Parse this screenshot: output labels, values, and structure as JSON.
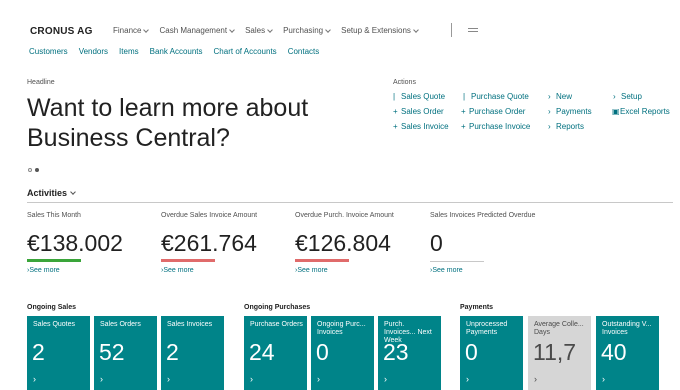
{
  "brand": "CRONUS AG",
  "menu": [
    {
      "label": "Finance",
      "key": "finance"
    },
    {
      "label": "Cash Management",
      "key": "cash-management"
    },
    {
      "label": "Sales",
      "key": "sales"
    },
    {
      "label": "Purchasing",
      "key": "purchasing"
    },
    {
      "label": "Setup & Extensions",
      "key": "setup-extensions"
    }
  ],
  "sublinks": [
    "Customers",
    "Vendors",
    "Items",
    "Bank Accounts",
    "Chart of Accounts",
    "Contacts"
  ],
  "headline": {
    "label": "Headline",
    "text": "Want to learn more about Business Central?"
  },
  "actions": {
    "label": "Actions",
    "items": [
      {
        "sym": "|",
        "label": "Sales Quote"
      },
      {
        "sym": "|",
        "label": "Purchase Quote"
      },
      {
        "sym": "›",
        "label": "New"
      },
      {
        "sym": "›",
        "label": "Setup"
      },
      {
        "sym": "+",
        "label": "Sales Order"
      },
      {
        "sym": "+",
        "label": "Purchase Order"
      },
      {
        "sym": "›",
        "label": "Payments"
      },
      {
        "sym": "▣",
        "label": "Excel Reports"
      },
      {
        "sym": "+",
        "label": "Sales Invoice"
      },
      {
        "sym": "+",
        "label": "Purchase Invoice"
      },
      {
        "sym": "›",
        "label": "Reports"
      }
    ]
  },
  "activities": {
    "title": "Activities",
    "kpis": [
      {
        "label": "Sales This Month",
        "value": "€138.002",
        "more": "See more",
        "bar_color": "#3aa53a"
      },
      {
        "label": "Overdue Sales Invoice Amount",
        "value": "€261.764",
        "more": "See more",
        "bar_color": "#e06b6b"
      },
      {
        "label": "Overdue Purch. Invoice Amount",
        "value": "€126.804",
        "more": "See more",
        "bar_color": "#e06b6b"
      },
      {
        "label": "Sales Invoices Predicted Overdue",
        "value": "0",
        "more": "See more",
        "bar_color": ""
      }
    ]
  },
  "groups": [
    {
      "label": "Ongoing Sales",
      "tiles": [
        {
          "label": "Sales Quotes",
          "value": "2"
        },
        {
          "label": "Sales Orders",
          "value": "52"
        },
        {
          "label": "Sales Invoices",
          "value": "2"
        }
      ]
    },
    {
      "label": "Ongoing Purchases",
      "tiles": [
        {
          "label": "Purchase Orders",
          "value": "24"
        },
        {
          "label": "Ongoing Purc... Invoices",
          "value": "0"
        },
        {
          "label": "Purch. Invoices... Next Week",
          "value": "23"
        }
      ]
    },
    {
      "label": "Payments",
      "tiles": [
        {
          "label": "Unprocessed Payments",
          "value": "0"
        },
        {
          "label": "Average Colle... Days",
          "value": "11,7"
        },
        {
          "label": "Outstanding V... Invoices",
          "value": "40"
        }
      ]
    }
  ],
  "tile_chevron": "›"
}
